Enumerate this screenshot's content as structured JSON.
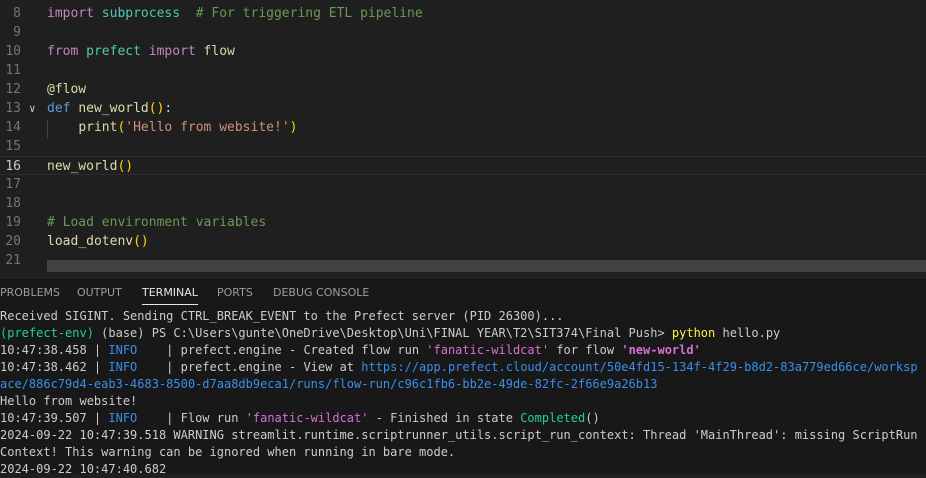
{
  "editor": {
    "lines": [
      {
        "num": "8",
        "tokens": [
          {
            "t": "import",
            "c": "kw"
          },
          {
            "t": " subprocess  ",
            "c": "mod"
          },
          {
            "t": "# For triggering ETL pipeline",
            "c": "cmt"
          }
        ]
      },
      {
        "num": "9",
        "tokens": []
      },
      {
        "num": "10",
        "tokens": [
          {
            "t": "from",
            "c": "kw"
          },
          {
            "t": " prefect ",
            "c": "mod"
          },
          {
            "t": "import",
            "c": "kw"
          },
          {
            "t": " flow",
            "c": "fn"
          }
        ]
      },
      {
        "num": "11",
        "tokens": []
      },
      {
        "num": "12",
        "tokens": [
          {
            "t": "@flow",
            "c": "dec"
          }
        ]
      },
      {
        "num": "13",
        "fold": true,
        "tokens": [
          {
            "t": "def",
            "c": "kw-def"
          },
          {
            "t": " ",
            "c": "plain"
          },
          {
            "t": "new_world",
            "c": "fn"
          },
          {
            "t": "()",
            "c": "paren"
          },
          {
            "t": ":",
            "c": "plain"
          }
        ]
      },
      {
        "num": "14",
        "tokens": [
          {
            "t": "    ",
            "c": "plain"
          },
          {
            "t": "print",
            "c": "fn"
          },
          {
            "t": "(",
            "c": "paren"
          },
          {
            "t": "'Hello from website!'",
            "c": "str"
          },
          {
            "t": ")",
            "c": "paren"
          }
        ]
      },
      {
        "num": "15",
        "tokens": []
      },
      {
        "num": "16",
        "active": true,
        "tokens": [
          {
            "t": "new_world",
            "c": "fn"
          },
          {
            "t": "()",
            "c": "paren"
          }
        ]
      },
      {
        "num": "17",
        "tokens": []
      },
      {
        "num": "18",
        "tokens": []
      },
      {
        "num": "19",
        "tokens": [
          {
            "t": "# Load environment variables",
            "c": "cmt"
          }
        ]
      },
      {
        "num": "20",
        "tokens": [
          {
            "t": "load_dotenv",
            "c": "fn"
          },
          {
            "t": "()",
            "c": "paren"
          }
        ]
      },
      {
        "num": "21",
        "tokens": []
      }
    ]
  },
  "panel": {
    "tabs": [
      {
        "label": "PROBLEMS",
        "active": false
      },
      {
        "label": "OUTPUT",
        "active": false
      },
      {
        "label": "TERMINAL",
        "active": true
      },
      {
        "label": "PORTS",
        "active": false
      },
      {
        "label": "DEBUG CONSOLE",
        "active": false
      }
    ]
  },
  "terminal": {
    "lines": [
      [
        {
          "t": "Received SIGINT. Sending CTRL_BREAK_EVENT to the Prefect server (PID 26300)...",
          "c": ""
        }
      ],
      [
        {
          "t": "(prefect-env)",
          "c": "t-green"
        },
        {
          "t": " (base) PS C:\\Users\\gunte\\OneDrive\\Desktop\\Uni\\FINAL YEAR\\T2\\SIT374\\Final Push> ",
          "c": ""
        },
        {
          "t": "python",
          "c": "t-yellow"
        },
        {
          "t": " hello.py",
          "c": ""
        }
      ],
      [
        {
          "t": "10:47:38.458 | ",
          "c": ""
        },
        {
          "t": "INFO",
          "c": "t-blue"
        },
        {
          "t": "    | prefect.engine - Created flow run ",
          "c": ""
        },
        {
          "t": "'fanatic-wildcat'",
          "c": "t-magenta"
        },
        {
          "t": " for flow ",
          "c": ""
        },
        {
          "t": "'new-world'",
          "c": "t-magenta t-bold"
        }
      ],
      [
        {
          "t": "10:47:38.462 | ",
          "c": ""
        },
        {
          "t": "INFO",
          "c": "t-blue"
        },
        {
          "t": "    | prefect.engine - View at ",
          "c": ""
        },
        {
          "t": "https://app.prefect.cloud/account/50e4fd15-134f-4f29-b8d2-83a779ed66ce/worksp",
          "c": "t-blue"
        }
      ],
      [
        {
          "t": "ace/886c79d4-eab3-4683-8500-d7aa8db9eca1/runs/flow-run/c96c1fb6-bb2e-49de-82fc-2f66e9a26b13",
          "c": "t-blue"
        }
      ],
      [
        {
          "t": "Hello from website!",
          "c": ""
        }
      ],
      [
        {
          "t": "10:47:39.507 | ",
          "c": ""
        },
        {
          "t": "INFO",
          "c": "t-blue"
        },
        {
          "t": "    | Flow run ",
          "c": ""
        },
        {
          "t": "'fanatic-wildcat'",
          "c": "t-magenta"
        },
        {
          "t": " - Finished in state ",
          "c": ""
        },
        {
          "t": "Completed",
          "c": "t-green"
        },
        {
          "t": "()",
          "c": ""
        }
      ],
      [
        {
          "t": "2024-09-22 10:47:39.518 WARNING streamlit.runtime.scriptrunner_utils.script_run_context: Thread 'MainThread': missing ScriptRun",
          "c": ""
        }
      ],
      [
        {
          "t": "Context! This warning can be ignored when running in bare mode.",
          "c": ""
        }
      ],
      [
        {
          "t": "2024-09-22 10:47:40.682",
          "c": ""
        }
      ]
    ]
  }
}
